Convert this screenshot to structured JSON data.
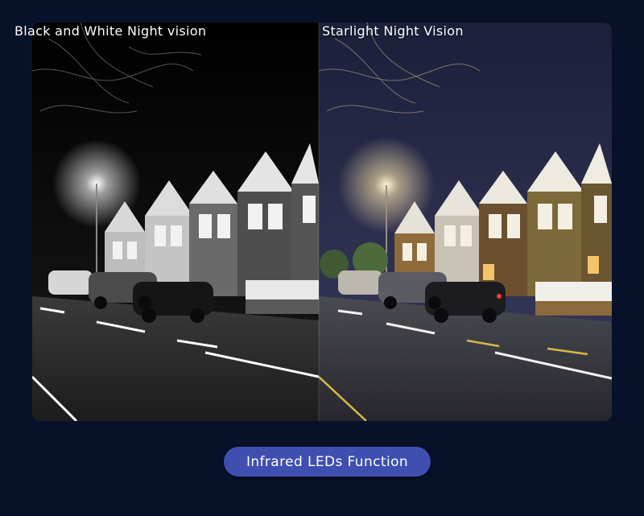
{
  "captions": {
    "left": "Black and White Night vision",
    "right": "Starlight Night Vision"
  },
  "button": {
    "label": "Infrared LEDs Function"
  },
  "colors": {
    "page_background": "#07112a",
    "button_background": "#3f4fb0",
    "button_text": "#ffffff"
  }
}
